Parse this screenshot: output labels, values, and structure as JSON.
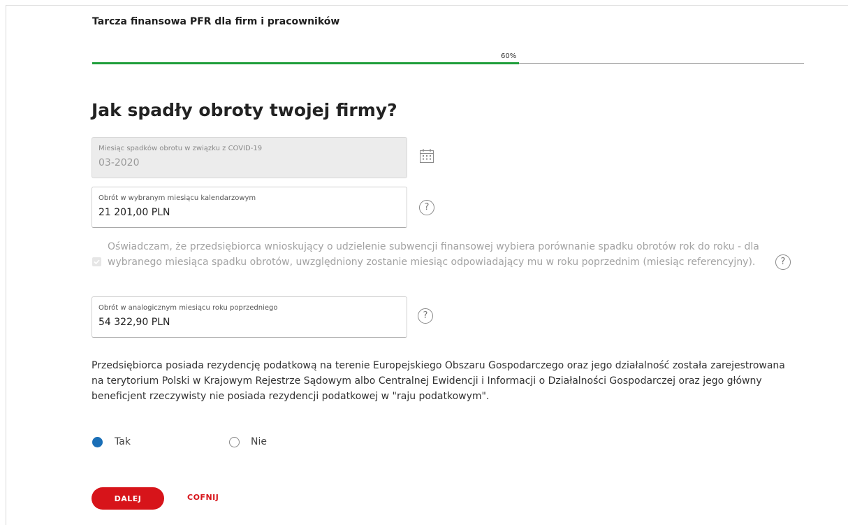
{
  "header": {
    "title": "Tarcza finansowa PFR dla firm i pracowników"
  },
  "progress": {
    "label": "60%",
    "value": 0.6,
    "fill_color": "#1e9e3a"
  },
  "page": {
    "title": "Jak spadły obroty twojej firmy?"
  },
  "fields": {
    "covid_month": {
      "label": "Miesiąc spadków obrotu w związku z COVID-19",
      "value": "03-2020",
      "icon": "calendar-icon",
      "disabled": true
    },
    "turnover_selected": {
      "label": "Obrót w wybranym miesiącu kalendarzowym",
      "value": "21 201,00 PLN",
      "icon": "help-icon"
    },
    "turnover_previous": {
      "label": "Obrót w analogicznym miesiącu roku poprzedniego",
      "value": "54 322,90 PLN",
      "icon": "help-icon"
    }
  },
  "declaration": {
    "checked": true,
    "disabled": true,
    "text": "Oświadczam, że przedsiębiorca wnioskujący o udzielenie subwencji finansowej wybiera porównanie spadku obrotów rok do roku - dla wybranego miesiąca spadku obrotów, uwzględniony zostanie miesiąc odpowiadający mu w roku poprzednim (miesiąc referencyjny).",
    "icon": "help-icon"
  },
  "tax_residency": {
    "question": "Przedsiębiorca posiada rezydencję podatkową na terenie Europejskiego Obszaru Gospodarczego oraz jego działalność została zarejestrowana na terytorium Polski w Krajowym Rejestrze Sądowym albo Centralnej Ewidencji i Informacji o Działalności Gospodarczej oraz jego główny beneficjent rzeczywisty nie posiada rezydencji podatkowej w \"raju podatkowym\".",
    "options": [
      {
        "label": "Tak",
        "selected": true
      },
      {
        "label": "Nie",
        "selected": false
      }
    ]
  },
  "actions": {
    "next_label": "DALEJ",
    "back_label": "COFNIJ"
  },
  "colors": {
    "accent": "#d7141a",
    "radio_selected": "#1a6fb7"
  }
}
